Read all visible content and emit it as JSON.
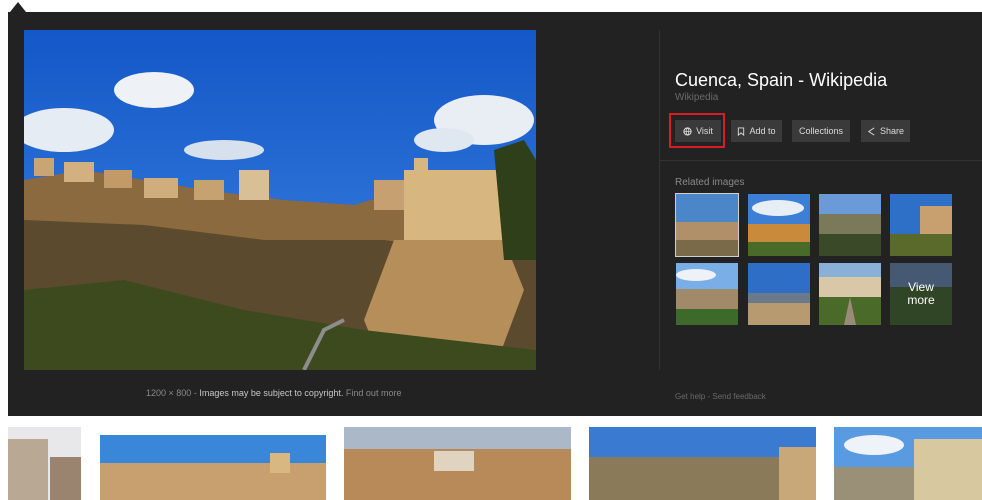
{
  "panel": {
    "title": "Cuenca, Spain - Wikipedia",
    "source": "Wikipedia",
    "buttons": {
      "visit": "Visit",
      "add_to": "Add to",
      "collections": "Collections",
      "share": "Share"
    },
    "related_label": "Related images",
    "view_more": "View\nmore",
    "footer": {
      "get_help": "Get help",
      "separator": "-",
      "send_feedback": "Send feedback"
    }
  },
  "caption": {
    "dimensions": "1200 × 800",
    "separator": "-",
    "copyright": "Images may be subject to copyright.",
    "find_out_more": "Find out more"
  },
  "colors": {
    "panel_bg": "#222222",
    "button_bg": "#3a3a3a",
    "highlight": "#d91d24"
  },
  "icons": {
    "visit": "globe-icon",
    "add_to": "bookmark-icon",
    "share": "share-icon"
  }
}
